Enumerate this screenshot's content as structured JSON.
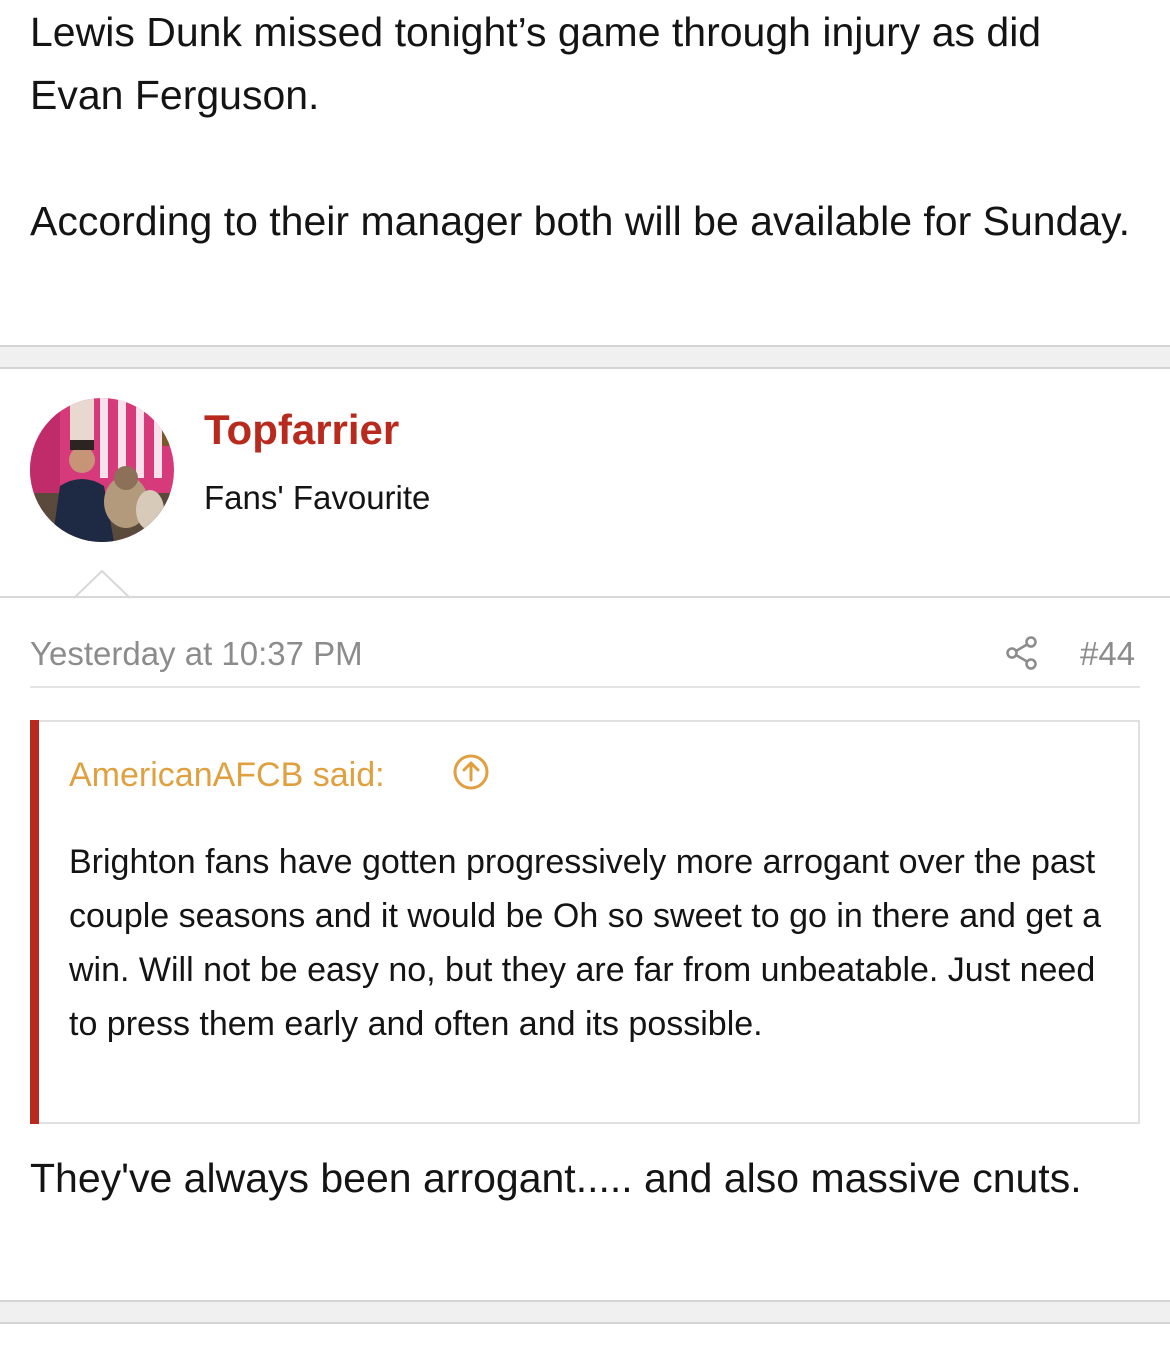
{
  "previous_post": {
    "paragraphs": [
      "Lewis Dunk missed tonight’s game through injury as did Evan Ferguson.",
      "According to their manager both will be available for Sunday."
    ]
  },
  "post": {
    "username": "Topfarrier",
    "user_title": "Fans' Favourite",
    "timestamp": "Yesterday at 10:37 PM",
    "post_number": "#44",
    "quote": {
      "author": "AmericanAFCB said:",
      "text": "Brighton fans have gotten progressively more arrogant over the past couple seasons and it would be Oh so sweet to go in there and get a win. Will not be easy no, but they are far from unbeatable. Just need to press them early and often and its possible."
    },
    "body": "They've always been arrogant..... and also massive cnuts."
  },
  "colors": {
    "username": "#b82a1e",
    "quote_author": "#e0a040",
    "quote_bar": "#b82a1e",
    "meta_text": "#8c8c8c"
  },
  "icons": {
    "share": "share-icon",
    "quote_jump": "arrow-up-circle-icon"
  }
}
